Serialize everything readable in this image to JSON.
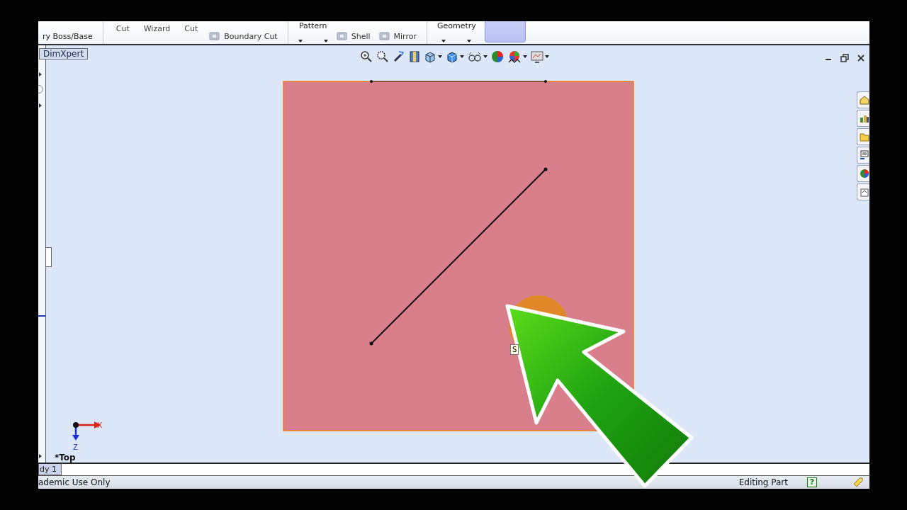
{
  "ribbon": {
    "groups": [
      {
        "kind": "low",
        "label": "ry Boss/Base"
      },
      {
        "kind": "separator"
      },
      {
        "kind": "mid",
        "label": "Cut"
      },
      {
        "kind": "mid",
        "label": "Wizard"
      },
      {
        "kind": "mid",
        "label": "Cut"
      },
      {
        "kind": "icon-low",
        "label": "Boundary Cut"
      },
      {
        "kind": "separator"
      },
      {
        "kind": "high-caret",
        "label": "Pattern"
      },
      {
        "kind": "icon-low",
        "label": "Shell"
      },
      {
        "kind": "icon-low",
        "label": "Mirror"
      },
      {
        "kind": "separator"
      },
      {
        "kind": "high-caret",
        "label": "Geometry"
      },
      {
        "kind": "blank-button"
      }
    ]
  },
  "dimxpert_tab": {
    "label": "DimXpert"
  },
  "viewport": {
    "view_label": "*Top",
    "triad": {
      "x_label": "X",
      "z_label": "Z"
    },
    "tooltip": "S"
  },
  "bottom_tabs": [
    {
      "label": "dy 1",
      "selected": true
    }
  ],
  "status_bar": {
    "license": "ademic Use Only",
    "mode": "Editing Part",
    "help": "?"
  }
}
